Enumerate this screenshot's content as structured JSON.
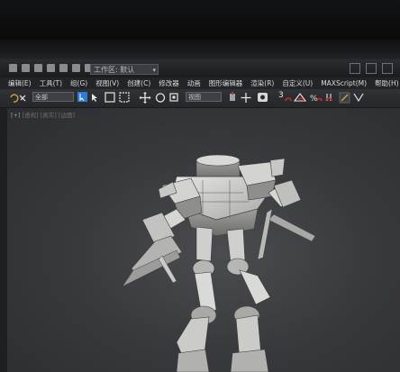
{
  "toolbar_quick": {
    "workspace_label": "工作区: 默认"
  },
  "menubar": {
    "items": [
      "编辑(E)",
      "工具(T)",
      "组(G)",
      "视图(V)",
      "创建(C)",
      "修改器",
      "动画",
      "图形编辑器",
      "渲染(R)",
      "自定义(U)",
      "MAXScript(M)",
      "帮助(H)"
    ]
  },
  "main_toolbar": {
    "selection_filter": "全部",
    "reference_coord": "视图",
    "snap_label": "3"
  },
  "viewport": {
    "label_parts": [
      "[+]",
      "[透视]",
      "[真实]",
      "[边面]"
    ]
  },
  "colors": {
    "accent_blue": "#2d7bd6",
    "snap_red": "#c43030",
    "menu_text": "#d9dadc"
  }
}
